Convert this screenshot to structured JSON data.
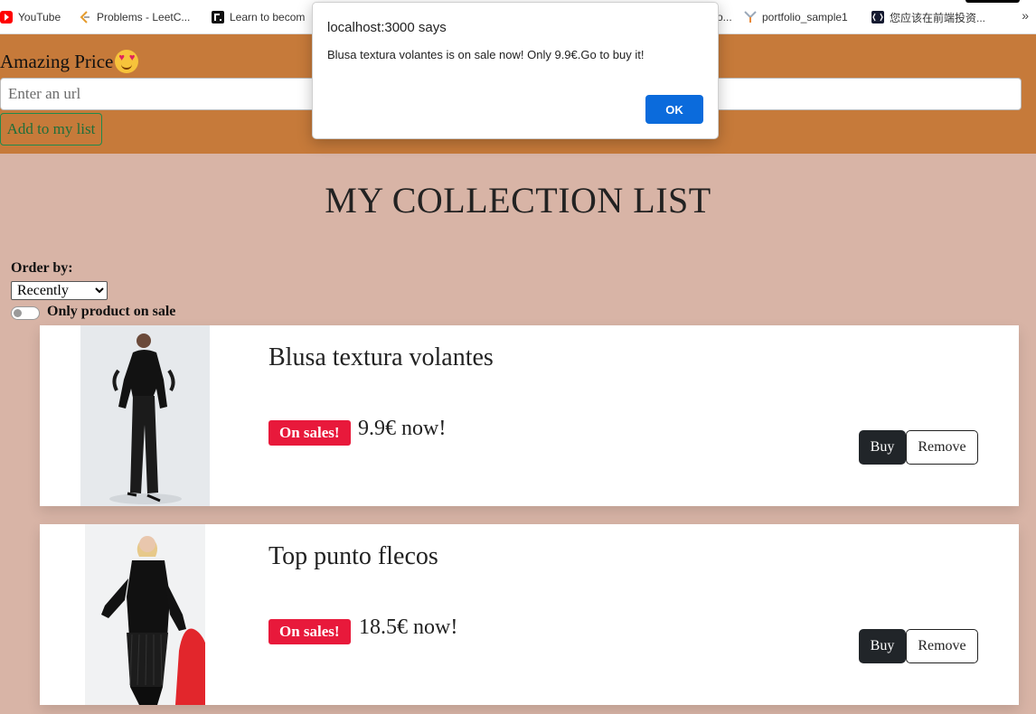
{
  "bookmarks": [
    {
      "label": "YouTube",
      "icon": "youtube-icon"
    },
    {
      "label": "Problems - LeetC...",
      "icon": "leetcode-icon"
    },
    {
      "label": "Learn to becom",
      "icon": "bookmark-dark-icon"
    },
    {
      "label": "o...",
      "icon": ""
    },
    {
      "label": "portfolio_sample1",
      "icon": "portfolio-icon"
    },
    {
      "label": "您应该在前端投资...",
      "icon": "site-icon"
    }
  ],
  "bookmarks_more": "»",
  "header": {
    "brand": "Amazing Price",
    "url_placeholder": "Enter an url",
    "add_button": "Add to my list"
  },
  "main": {
    "title": "MY COLLECTION LIST",
    "order_label": "Order by:",
    "order_value": "Recently",
    "sale_toggle_label": "Only product on sale"
  },
  "products": [
    {
      "name": "Blusa textura volantes",
      "badge": "On sales!",
      "price": "9.9€ now!",
      "buy": "Buy",
      "remove": "Remove"
    },
    {
      "name": "Top punto flecos",
      "badge": "On sales!",
      "price": "18.5€ now!",
      "buy": "Buy",
      "remove": "Remove"
    }
  ],
  "dialog": {
    "title": "localhost:3000 says",
    "message": "Blusa textura volantes is on sale now! Only 9.9€.Go to buy it!",
    "ok": "OK"
  },
  "colors": {
    "header_bg": "#c67a3a",
    "page_bg": "#d8b4a6",
    "sale_badge": "#e8193b",
    "ok_button": "#0b6bdc",
    "buy_button": "#212529"
  }
}
